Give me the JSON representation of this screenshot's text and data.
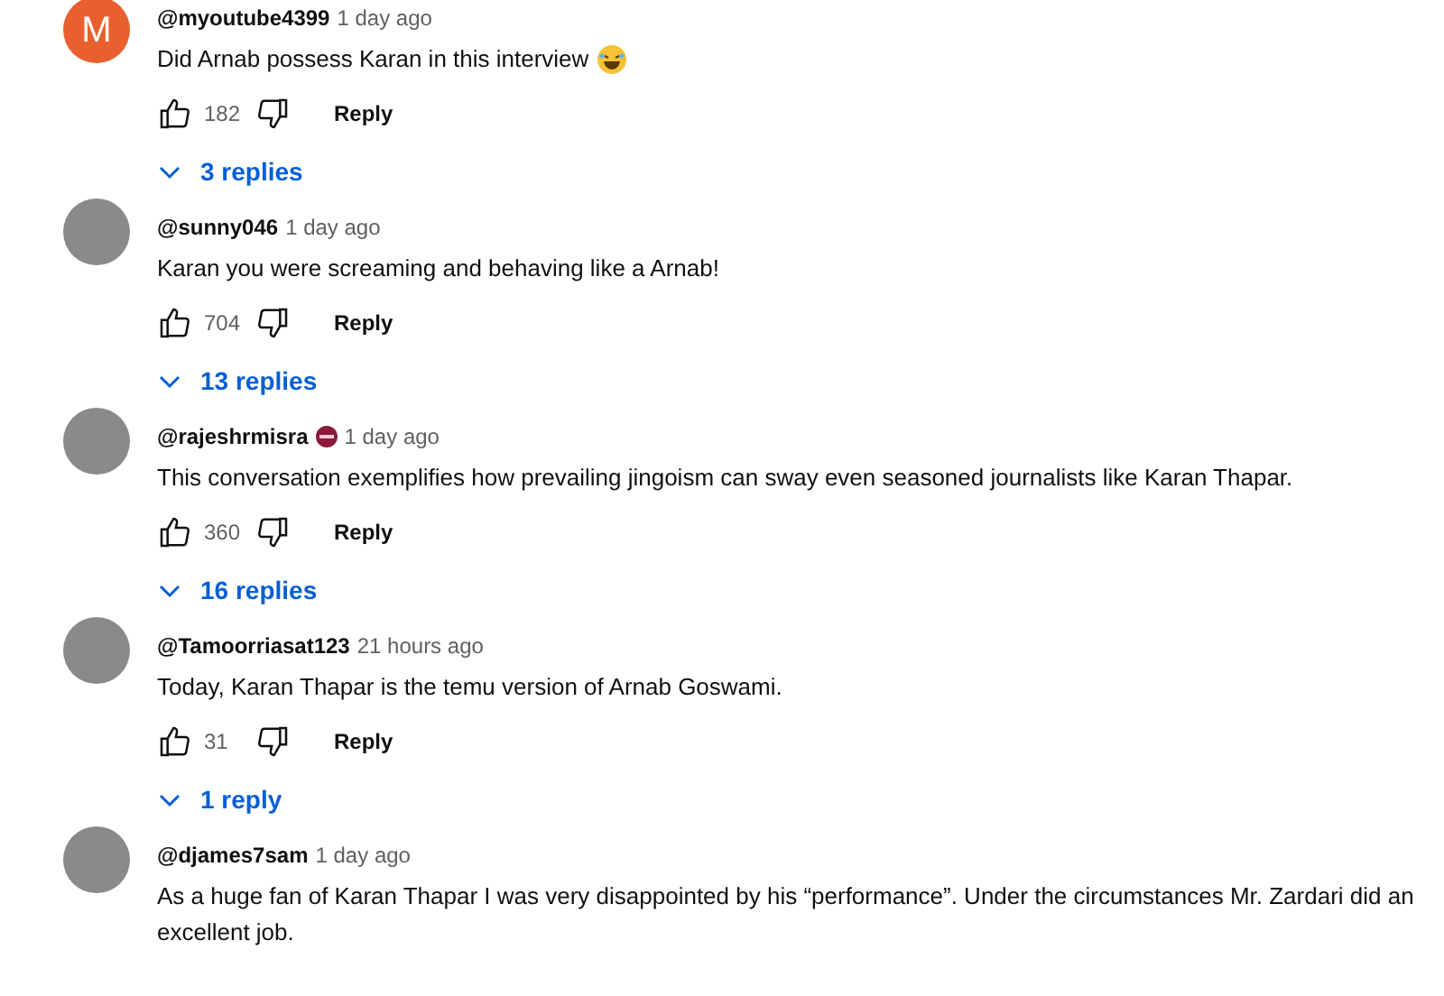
{
  "comments": [
    {
      "avatar": {
        "kind": "letter",
        "letter": "M",
        "color": "#e9602f"
      },
      "handle": "@myoutube4399",
      "badge": false,
      "time": "1 day ago",
      "text": "Did Arnab possess Karan in this interview",
      "emoji": true,
      "likes": "182",
      "reply": "Reply",
      "replies": "3 replies"
    },
    {
      "avatar": {
        "kind": "photo"
      },
      "handle": "@sunny046",
      "badge": false,
      "time": "1 day ago",
      "text": "Karan you were screaming and behaving like a Arnab!",
      "emoji": false,
      "likes": "704",
      "reply": "Reply",
      "replies": "13 replies"
    },
    {
      "avatar": {
        "kind": "photo"
      },
      "handle": "@rajeshrmisra",
      "badge": true,
      "time": "1 day ago",
      "text": "This conversation exemplifies how prevailing jingoism can sway even seasoned journalists like Karan Thapar.",
      "emoji": false,
      "likes": "360",
      "reply": "Reply",
      "replies": "16 replies"
    },
    {
      "avatar": {
        "kind": "photo"
      },
      "handle": "@Tamoorriasat123",
      "badge": false,
      "time": "21 hours ago",
      "text": "Today, Karan Thapar is the temu version of Arnab Goswami.",
      "emoji": false,
      "likes": "31",
      "reply": "Reply",
      "replies": "1 reply"
    },
    {
      "avatar": {
        "kind": "photo"
      },
      "handle": "@djames7sam",
      "badge": false,
      "time": "1 day ago",
      "text": "As a huge fan of Karan Thapar I was very disappointed by his “performance”. Under the circumstances Mr. Zardari did an excellent job.",
      "emoji": false
    }
  ]
}
